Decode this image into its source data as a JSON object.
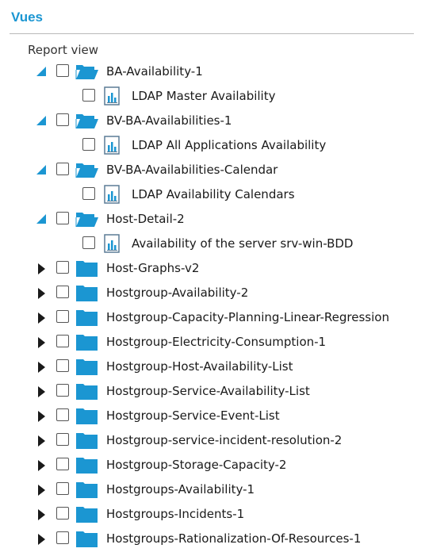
{
  "section_title": "Vues",
  "root_label": "Report view",
  "tree": [
    {
      "type": "folder",
      "state": "expanded",
      "label": "BA-Availability-1",
      "children": [
        {
          "type": "report",
          "label": "LDAP Master Availability"
        }
      ]
    },
    {
      "type": "folder",
      "state": "expanded",
      "label": "BV-BA-Availabilities-1",
      "children": [
        {
          "type": "report",
          "label": "LDAP All Applications Availability"
        }
      ]
    },
    {
      "type": "folder",
      "state": "expanded",
      "label": "BV-BA-Availabilities-Calendar",
      "children": [
        {
          "type": "report",
          "label": "LDAP Availability Calendars"
        }
      ]
    },
    {
      "type": "folder",
      "state": "expanded",
      "label": "Host-Detail-2",
      "children": [
        {
          "type": "report",
          "label": "Availability of the server srv-win-BDD"
        }
      ]
    },
    {
      "type": "folder",
      "state": "collapsed",
      "label": "Host-Graphs-v2"
    },
    {
      "type": "folder",
      "state": "collapsed",
      "label": "Hostgroup-Availability-2"
    },
    {
      "type": "folder",
      "state": "collapsed",
      "label": "Hostgroup-Capacity-Planning-Linear-Regression"
    },
    {
      "type": "folder",
      "state": "collapsed",
      "label": "Hostgroup-Electricity-Consumption-1"
    },
    {
      "type": "folder",
      "state": "collapsed",
      "label": "Hostgroup-Host-Availability-List"
    },
    {
      "type": "folder",
      "state": "collapsed",
      "label": "Hostgroup-Service-Availability-List"
    },
    {
      "type": "folder",
      "state": "collapsed",
      "label": "Hostgroup-Service-Event-List"
    },
    {
      "type": "folder",
      "state": "collapsed",
      "label": "Hostgroup-service-incident-resolution-2"
    },
    {
      "type": "folder",
      "state": "collapsed",
      "label": "Hostgroup-Storage-Capacity-2"
    },
    {
      "type": "folder",
      "state": "collapsed",
      "label": "Hostgroups-Availability-1"
    },
    {
      "type": "folder",
      "state": "collapsed",
      "label": "Hostgroups-Incidents-1"
    },
    {
      "type": "folder",
      "state": "collapsed",
      "label": "Hostgroups-Rationalization-Of-Resources-1"
    }
  ],
  "colors": {
    "accent": "#1b96d2",
    "folder_closed": "#1b96d2",
    "folder_open": "#1b96d2"
  },
  "icons": {
    "expanded": "triangle-down-icon",
    "collapsed": "triangle-right-icon",
    "folder_open": "folder-open-icon",
    "folder_closed": "folder-icon",
    "report": "report-chart-icon"
  }
}
